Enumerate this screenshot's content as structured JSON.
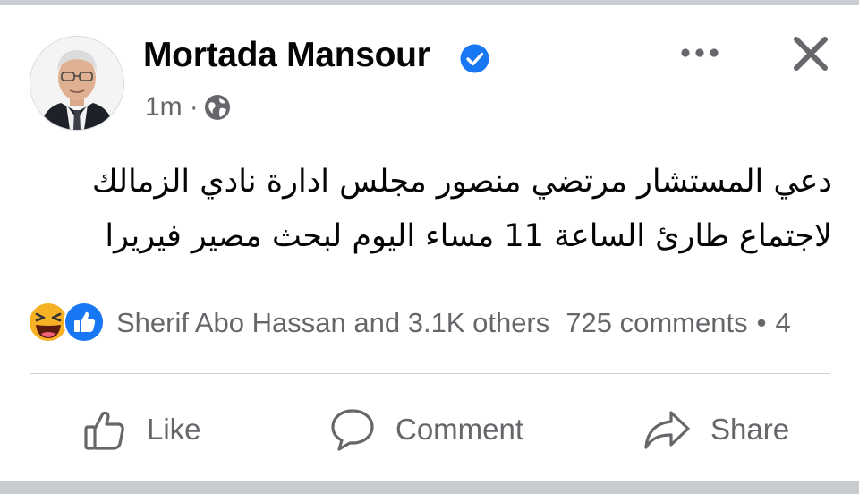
{
  "post": {
    "author": "Mortada Mansour",
    "time": "1m",
    "separator": "·",
    "privacy_icon": "globe-icon",
    "verified_icon": "verified-badge-icon",
    "text_lines": [
      "دعي المستشار مرتضي منصور مجلس ادارة نادي الزمالك",
      "لاجتماع طارئ الساعة 11 مساء اليوم لبحث مصير فيريرا"
    ]
  },
  "header_actions": {
    "more_icon": "more-options-icon",
    "close_icon": "close-icon"
  },
  "reactions": {
    "icons": [
      "haha-icon",
      "like-icon"
    ],
    "summary": "Sherif Abo Hassan and 3.1K others",
    "comments": "725 comments",
    "separator": "•",
    "shares": "4"
  },
  "actions": {
    "like": "Like",
    "comment": "Comment",
    "share": "Share"
  },
  "colors": {
    "verified_blue": "#1877f2",
    "secondary_text": "#65676b",
    "like_blue": "#1877f2",
    "haha_yellow": "#f7b125",
    "frame_gray": "#c9ccd1"
  }
}
